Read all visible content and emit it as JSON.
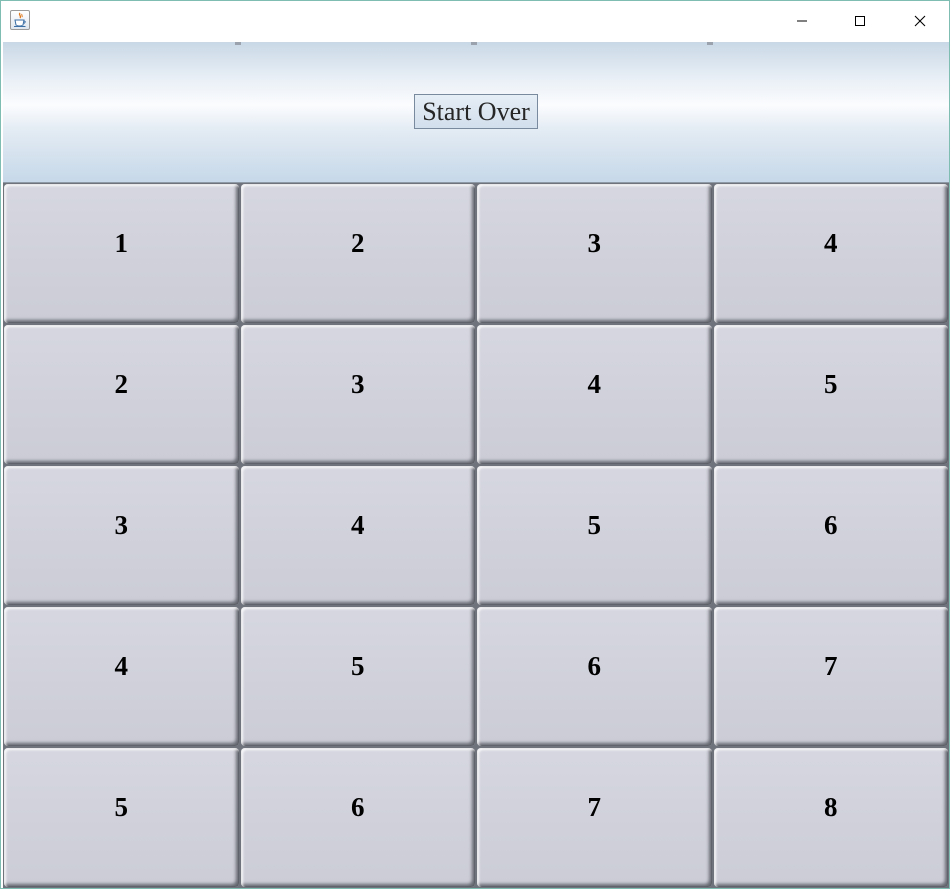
{
  "window": {
    "icon": "java-cup-icon",
    "controls": [
      "minimize-icon",
      "maximize-icon",
      "close-icon"
    ]
  },
  "toolbar": {
    "start_over_label": "Start Over"
  },
  "grid": {
    "rows": [
      [
        "1",
        "2",
        "3",
        "4"
      ],
      [
        "2",
        "3",
        "4",
        "5"
      ],
      [
        "3",
        "4",
        "5",
        "6"
      ],
      [
        "4",
        "5",
        "6",
        "7"
      ],
      [
        "5",
        "6",
        "7",
        "8"
      ]
    ]
  },
  "colors": {
    "tile": "#d0d1db",
    "tile_border": "#6f737c",
    "panel_top": "#c9d8e6",
    "panel_mid": "#fbfcfe",
    "window_border": "#7fbcb2"
  }
}
